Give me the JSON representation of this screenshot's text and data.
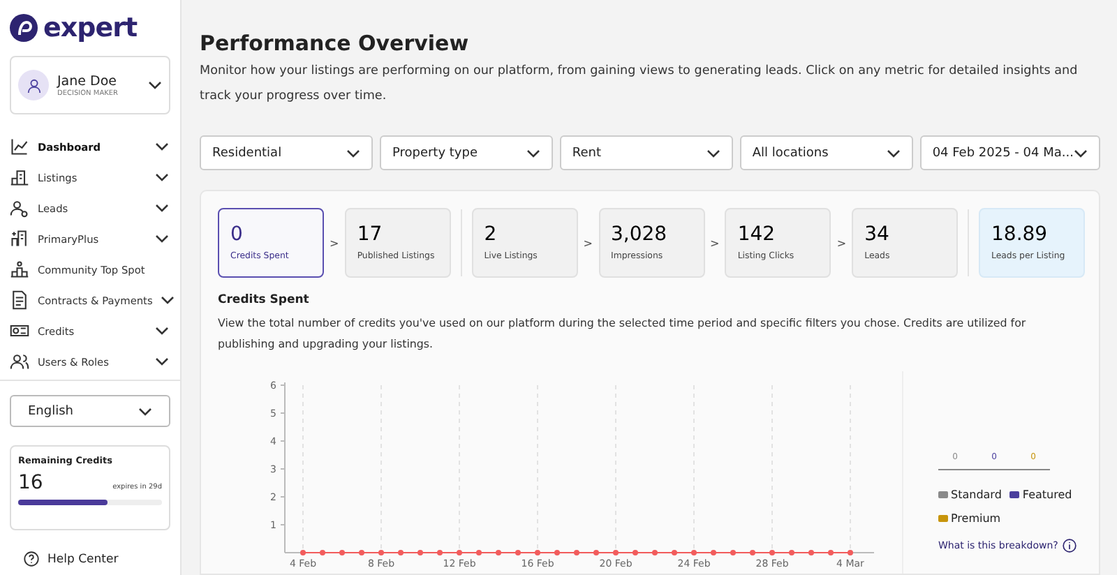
{
  "sidebar": {
    "logo": "expert",
    "user": {
      "name": "Jane Doe",
      "role": "DECISION MAKER"
    },
    "items": [
      {
        "label": "Dashboard",
        "selected": true,
        "has_submenu": true
      },
      {
        "label": "Listings",
        "selected": false,
        "has_submenu": true
      },
      {
        "label": "Leads",
        "selected": false,
        "has_submenu": true
      },
      {
        "label": "PrimaryPlus",
        "selected": false,
        "has_submenu": true
      },
      {
        "label": "Community Top Spot",
        "selected": false,
        "has_submenu": false
      },
      {
        "label": "Contracts & Payments",
        "selected": false,
        "has_submenu": true
      },
      {
        "label": "Credits",
        "selected": false,
        "has_submenu": true
      },
      {
        "label": "Users & Roles",
        "selected": false,
        "has_submenu": true
      }
    ],
    "language": "English",
    "credits": {
      "title": "Remaining Credits",
      "value": "16",
      "expiry": "expires in 29d",
      "level": 0.62
    },
    "help": "Help Center"
  },
  "page": {
    "title": "Performance Overview",
    "description": "Monitor how your listings are performing on our platform, from gaining views to generating leads. Click on any metric for detailed insights and track your progress over time."
  },
  "filters": [
    "Residential",
    "Property type",
    "Rent",
    "All locations",
    "04 Feb 2025 - 04 Ma..."
  ],
  "metrics": [
    {
      "kind": "metric",
      "value": "0",
      "label": "Credits Spent",
      "selected": true,
      "arrow": ">"
    },
    {
      "kind": "metric",
      "value": "17",
      "label": "Published Listings",
      "selected": false
    },
    {
      "kind": "metric",
      "value": "2",
      "label": "Live Listings",
      "selected": false,
      "arrow": ">"
    },
    {
      "kind": "metric",
      "value": "3,028",
      "label": "Impressions",
      "selected": false,
      "arrow": ">"
    },
    {
      "kind": "metric",
      "value": "142",
      "label": "Listing Clicks",
      "selected": false,
      "arrow": ">"
    },
    {
      "kind": "metric",
      "value": "34",
      "label": "Leads",
      "selected": false
    },
    {
      "kind": "ratio",
      "value": "18.89",
      "label": "Leads per Listing",
      "selected": false
    }
  ],
  "detail": {
    "title": "Credits Spent",
    "description": "View the total number of credits you've used on our platform during the selected time period and specific filters you chose. Credits are utilized for publishing and upgrading your listings.",
    "chart_data": {
      "type": "line",
      "categories": [
        "4 Feb",
        null,
        null,
        null,
        "8 Feb",
        null,
        null,
        null,
        "12 Feb",
        null,
        null,
        null,
        "16 Feb",
        null,
        null,
        null,
        "20 Feb",
        null,
        null,
        null,
        "24 Feb",
        null,
        null,
        null,
        "28 Feb",
        null,
        null,
        null,
        "4 Mar"
      ],
      "grid": true,
      "series": [
        {
          "marker": true,
          "color": "#f25c5c",
          "values": [
            0,
            0,
            0,
            0,
            0,
            0,
            0,
            0,
            0,
            0,
            0,
            0,
            0,
            0,
            0,
            0,
            0,
            0,
            0,
            0,
            0,
            0,
            0,
            0,
            0,
            0,
            0,
            0,
            0
          ]
        }
      ],
      "ylim": [
        0,
        6
      ],
      "yticks": [
        {
          "value": 1,
          "label": "1"
        },
        {
          "value": 2,
          "label": "2"
        },
        {
          "value": 3,
          "label": "3"
        },
        {
          "value": 4,
          "label": "4"
        },
        {
          "value": 5,
          "label": "5"
        },
        {
          "value": 6,
          "label": "6"
        }
      ]
    },
    "breakdown": [
      {
        "name": "Standard",
        "value": "0",
        "color": "#8a8a8a"
      },
      {
        "name": "Featured",
        "value": "0",
        "color": "#4b3f9e"
      },
      {
        "name": "Premium",
        "value": "0",
        "color": "#c7950c"
      }
    ],
    "breakdown_link": "What is this breakdown?"
  }
}
